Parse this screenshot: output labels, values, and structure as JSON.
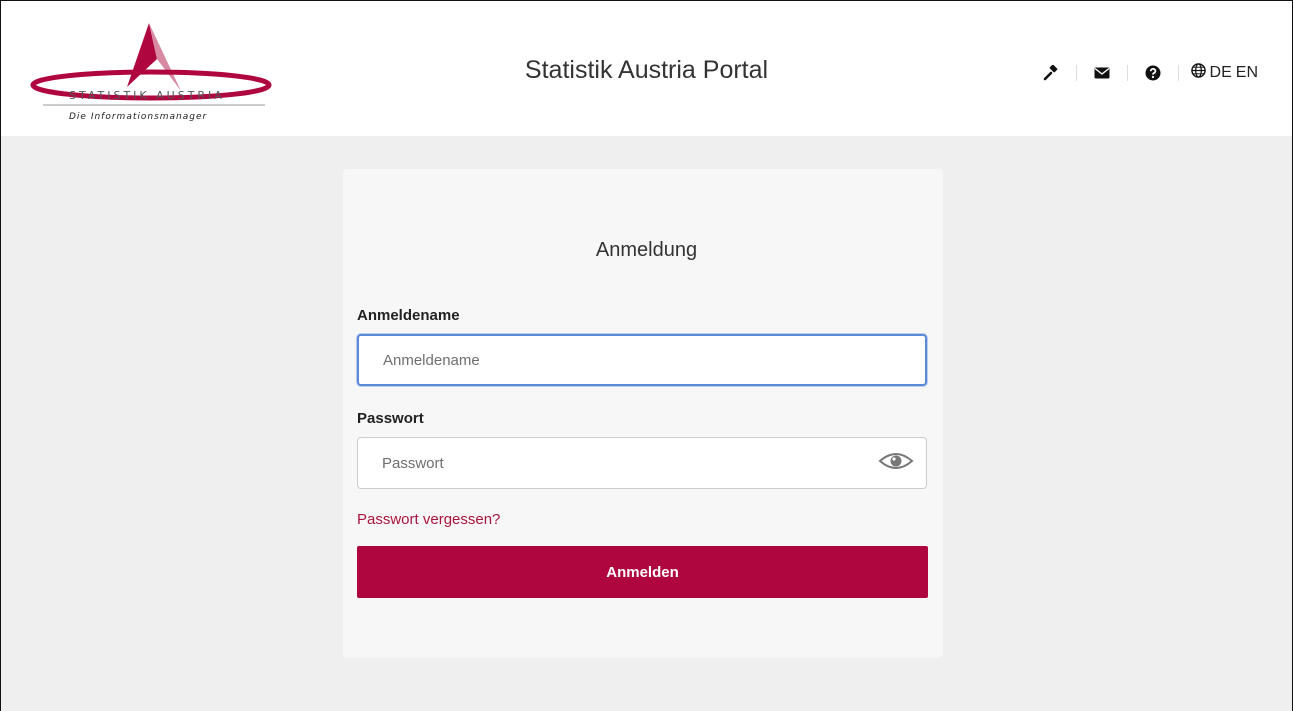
{
  "header": {
    "logo": {
      "wordmark": "STATISTIK AUSTRIA",
      "tagline": "Die Informationsmanager"
    },
    "title": "Statistik Austria Portal",
    "toolbar": {
      "icons": [
        "gavel-icon",
        "envelope-icon",
        "question-circle-icon",
        "globe-icon"
      ],
      "languages": [
        "DE",
        "EN"
      ]
    }
  },
  "login": {
    "title": "Anmeldung",
    "username": {
      "label": "Anmeldename",
      "placeholder": "Anmeldename",
      "value": ""
    },
    "password": {
      "label": "Passwort",
      "placeholder": "Passwort",
      "value": ""
    },
    "forgot_link": "Passwort vergessen?",
    "submit_label": "Anmelden"
  },
  "colors": {
    "brand": "#b0063f",
    "link": "#a8143f",
    "focus": "#5b8bd6",
    "background": "#efefef"
  }
}
